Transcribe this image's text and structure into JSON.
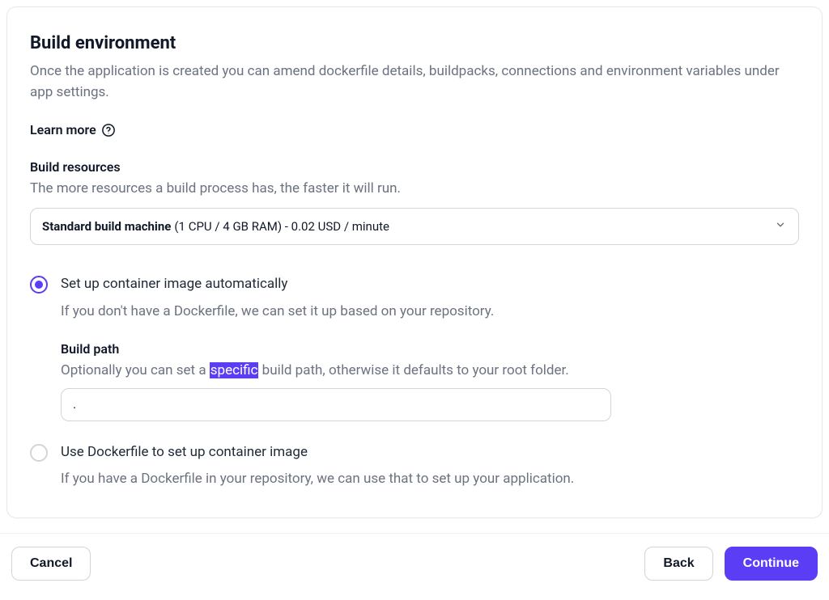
{
  "header": {
    "title": "Build environment",
    "description": "Once the application is created you can amend dockerfile details, buildpacks, connections and environment variables under app settings.",
    "learn_more_label": "Learn more"
  },
  "build_resources": {
    "label": "Build resources",
    "description": "The more resources a build process has, the faster it will run.",
    "selected_bold": "Standard build machine",
    "selected_rest": " (1 CPU / 4 GB RAM) - 0.02 USD / minute"
  },
  "container_options": {
    "auto": {
      "title": "Set up container image automatically",
      "description": "If you don't have a Dockerfile, we can set it up based on your repository.",
      "selected": true,
      "build_path": {
        "label": "Build path",
        "desc_pre": "Optionally you can set a ",
        "desc_highlight": "specific",
        "desc_post": " build path, otherwise it defaults to your root folder.",
        "value": "."
      }
    },
    "dockerfile": {
      "title": "Use Dockerfile to set up container image",
      "description": "If you have a Dockerfile in your repository, we can use that to set up your application.",
      "selected": false
    }
  },
  "footer": {
    "cancel": "Cancel",
    "back": "Back",
    "continue": "Continue"
  }
}
